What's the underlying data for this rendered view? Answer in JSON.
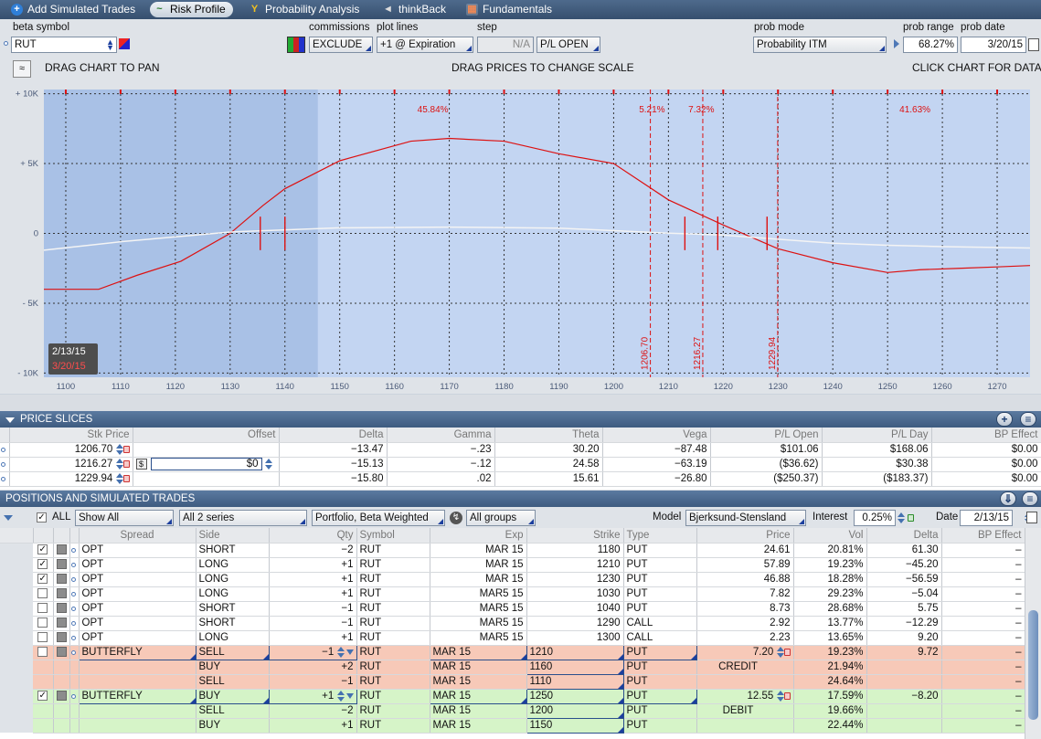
{
  "tabs": [
    {
      "label": "Add Simulated Trades",
      "icon": "plus-icon"
    },
    {
      "label": "Risk Profile",
      "icon": "risk-profile-icon",
      "active": true
    },
    {
      "label": "Probability Analysis",
      "icon": "probability-icon"
    },
    {
      "label": "thinkBack",
      "icon": "thinkback-icon"
    },
    {
      "label": "Fundamentals",
      "icon": "fundamentals-icon"
    }
  ],
  "settings": {
    "beta_symbol_label": "beta symbol",
    "beta_symbol": "RUT",
    "commissions_label": "commissions",
    "commissions": "EXCLUDE",
    "plot_lines_label": "plot lines",
    "plot_lines": "+1 @ Expiration",
    "step_label": "step",
    "step": "N/A",
    "pl_mode": "P/L OPEN",
    "prob_mode_label": "prob mode",
    "prob_mode": "Probability ITM",
    "prob_range_label": "prob range",
    "prob_range": "68.27%",
    "prob_date_label": "prob date",
    "prob_date": "3/20/15"
  },
  "chart_header": {
    "left": "DRAG CHART TO PAN",
    "center": "DRAG PRICES TO CHANGE SCALE",
    "right": "CLICK CHART FOR DATA"
  },
  "chart_data": {
    "type": "line",
    "xlim": [
      1096,
      1276
    ],
    "ylim": [
      -10300,
      10300
    ],
    "x_ticks": [
      1100,
      1110,
      1120,
      1130,
      1140,
      1150,
      1160,
      1170,
      1180,
      1190,
      1200,
      1210,
      1220,
      1230,
      1240,
      1250,
      1260,
      1270
    ],
    "y_ticks": [
      {
        "v": 10000,
        "label": "+ 10K"
      },
      {
        "v": 5000,
        "label": "+ 5K"
      },
      {
        "v": 0,
        "label": "0"
      },
      {
        "v": -5000,
        "label": "- 5K"
      },
      {
        "v": -10000,
        "label": "- 10K"
      }
    ],
    "series": [
      {
        "color": "#dd1111",
        "points": [
          [
            1096,
            -4000
          ],
          [
            1106,
            -4000
          ],
          [
            1113,
            -3000
          ],
          [
            1121,
            -2000
          ],
          [
            1130,
            0
          ],
          [
            1136,
            2000
          ],
          [
            1140,
            3200
          ],
          [
            1150,
            5200
          ],
          [
            1163,
            6600
          ],
          [
            1170,
            6800
          ],
          [
            1180,
            6600
          ],
          [
            1190,
            5700
          ],
          [
            1200,
            5000
          ],
          [
            1210,
            2400
          ],
          [
            1220,
            600
          ],
          [
            1230,
            -1100
          ],
          [
            1240,
            -2100
          ],
          [
            1250,
            -2800
          ],
          [
            1256,
            -2600
          ],
          [
            1263,
            -2500
          ],
          [
            1270,
            -2400
          ],
          [
            1276,
            -2300
          ]
        ]
      },
      {
        "color": "#f4f4f4",
        "points": [
          [
            1096,
            -1200
          ],
          [
            1110,
            -600
          ],
          [
            1130,
            100
          ],
          [
            1150,
            400
          ],
          [
            1170,
            450
          ],
          [
            1190,
            380
          ],
          [
            1200,
            200
          ],
          [
            1210,
            20
          ],
          [
            1215,
            -50
          ],
          [
            1220,
            -120
          ],
          [
            1230,
            -420
          ],
          [
            1240,
            -700
          ],
          [
            1250,
            -850
          ],
          [
            1260,
            -950
          ],
          [
            1276,
            -1050
          ]
        ]
      }
    ],
    "shaded_until": 1146,
    "vlines": [
      {
        "x": 1206.7,
        "label": "1206.70"
      },
      {
        "x": 1216.27,
        "label": "1216.27"
      },
      {
        "x": 1229.94,
        "label": "1229.94"
      }
    ],
    "zone_labels": [
      {
        "x": 1167,
        "text": "45.84%"
      },
      {
        "x": 1207,
        "text": "5.21%"
      },
      {
        "x": 1216,
        "text": "7.32%"
      },
      {
        "x": 1255,
        "text": "41.63%"
      }
    ],
    "markers": [
      {
        "x": 1135.5,
        "type": "cross"
      },
      {
        "x": 1140,
        "type": "cross"
      },
      {
        "x": 1213,
        "type": "cross"
      },
      {
        "x": 1219,
        "type": "cross"
      },
      {
        "x": 1228,
        "type": "cross"
      }
    ],
    "date_labels": [
      "2/13/15",
      "3/20/15"
    ]
  },
  "price_slices": {
    "title": "PRICE SLICES",
    "columns": [
      "Stk Price",
      "Offset",
      "Delta",
      "Gamma",
      "Theta",
      "Vega",
      "P/L Open",
      "P/L Day",
      "BP Effect"
    ],
    "rows": [
      {
        "price": "1206.70",
        "offset": "",
        "delta": "−13.47",
        "gamma": "−.23",
        "theta": "30.20",
        "vega": "−87.48",
        "pl_open": "$101.06",
        "pl_day": "$168.06",
        "bp": "$0.00"
      },
      {
        "price": "1216.27",
        "offset": "$0",
        "delta": "−15.13",
        "gamma": "−.12",
        "theta": "24.58",
        "vega": "−63.19",
        "pl_open": "($36.62)",
        "pl_day": "$30.38",
        "bp": "$0.00"
      },
      {
        "price": "1229.94",
        "offset": "",
        "delta": "−15.80",
        "gamma": ".02",
        "theta": "15.61",
        "vega": "−26.80",
        "pl_open": "($250.37)",
        "pl_day": "($183.37)",
        "bp": "$0.00"
      }
    ]
  },
  "positions": {
    "title": "POSITIONS AND SIMULATED TRADES",
    "all_label": "ALL",
    "show": "Show All",
    "series": "All 2 series",
    "portfolio": "Portfolio, Beta Weighted",
    "groups": "All groups",
    "model_label": "Model",
    "model": "Bjerksund-Stensland",
    "interest_label": "Interest",
    "interest": "0.25%",
    "date_label": "Date",
    "date": "2/13/15",
    "columns": [
      "Spread",
      "Side",
      "Qty",
      "Symbol",
      "Exp",
      "Strike",
      "Type",
      "Price",
      "Vol",
      "Delta",
      "BP Effect"
    ],
    "rows": [
      {
        "chk": true,
        "spread": "OPT",
        "side": "SHORT",
        "qty": "−2",
        "sym": "RUT",
        "exp": "MAR 15",
        "strike": "1180",
        "type": "PUT",
        "price": "24.61",
        "vol": "20.81%",
        "delta": "61.30",
        "bp": "–",
        "style": "white"
      },
      {
        "chk": true,
        "spread": "OPT",
        "side": "LONG",
        "qty": "+1",
        "sym": "RUT",
        "exp": "MAR 15",
        "strike": "1210",
        "type": "PUT",
        "price": "57.89",
        "vol": "19.23%",
        "delta": "−45.20",
        "bp": "–",
        "style": "white"
      },
      {
        "chk": true,
        "spread": "OPT",
        "side": "LONG",
        "qty": "+1",
        "sym": "RUT",
        "exp": "MAR 15",
        "strike": "1230",
        "type": "PUT",
        "price": "46.88",
        "vol": "18.28%",
        "delta": "−56.59",
        "bp": "–",
        "style": "white"
      },
      {
        "chk": false,
        "spread": "OPT",
        "side": "LONG",
        "qty": "+1",
        "sym": "RUT",
        "exp": "MAR5 15",
        "strike": "1030",
        "type": "PUT",
        "price": "7.82",
        "vol": "29.23%",
        "delta": "−5.04",
        "bp": "–",
        "style": "white"
      },
      {
        "chk": false,
        "spread": "OPT",
        "side": "SHORT",
        "qty": "−1",
        "sym": "RUT",
        "exp": "MAR5 15",
        "strike": "1040",
        "type": "PUT",
        "price": "8.73",
        "vol": "28.68%",
        "delta": "5.75",
        "bp": "–",
        "style": "white"
      },
      {
        "chk": false,
        "spread": "OPT",
        "side": "SHORT",
        "qty": "−1",
        "sym": "RUT",
        "exp": "MAR5 15",
        "strike": "1290",
        "type": "CALL",
        "price": "2.92",
        "vol": "13.77%",
        "delta": "−12.29",
        "bp": "–",
        "style": "white"
      },
      {
        "chk": false,
        "spread": "OPT",
        "side": "LONG",
        "qty": "+1",
        "sym": "RUT",
        "exp": "MAR5 15",
        "strike": "1300",
        "type": "CALL",
        "price": "2.23",
        "vol": "13.65%",
        "delta": "9.20",
        "bp": "–",
        "style": "white"
      },
      {
        "chk": false,
        "spread": "BUTTERFLY",
        "side": "SELL",
        "qty": "−1",
        "sym": "RUT",
        "exp": "MAR 15",
        "strike": "1210",
        "type": "PUT",
        "price": "7.20",
        "vol": "19.23%",
        "delta": "9.72",
        "bp": "–",
        "style": "pink",
        "lead": true
      },
      {
        "spread": "",
        "side": "BUY",
        "qty": "+2",
        "sym": "RUT",
        "exp": "MAR 15",
        "strike": "1160",
        "type": "PUT",
        "price": "CREDIT",
        "vol": "21.94%",
        "delta": "",
        "bp": "–",
        "style": "pink",
        "sub": true
      },
      {
        "spread": "",
        "side": "SELL",
        "qty": "−1",
        "sym": "RUT",
        "exp": "MAR 15",
        "strike": "1110",
        "type": "PUT",
        "price": "",
        "vol": "24.64%",
        "delta": "",
        "bp": "–",
        "style": "pink",
        "sub": true
      },
      {
        "chk": true,
        "spread": "BUTTERFLY",
        "side": "BUY",
        "qty": "+1",
        "sym": "RUT",
        "exp": "MAR 15",
        "strike": "1250",
        "type": "PUT",
        "price": "12.55",
        "vol": "17.59%",
        "delta": "−8.20",
        "bp": "–",
        "style": "green",
        "lead": true
      },
      {
        "spread": "",
        "side": "SELL",
        "qty": "−2",
        "sym": "RUT",
        "exp": "MAR 15",
        "strike": "1200",
        "type": "PUT",
        "price": "DEBIT",
        "vol": "19.66%",
        "delta": "",
        "bp": "–",
        "style": "green",
        "sub": true
      },
      {
        "spread": "",
        "side": "BUY",
        "qty": "+1",
        "sym": "RUT",
        "exp": "MAR 15",
        "strike": "1150",
        "type": "PUT",
        "price": "",
        "vol": "22.44%",
        "delta": "",
        "bp": "–",
        "style": "green",
        "sub": true
      }
    ]
  }
}
